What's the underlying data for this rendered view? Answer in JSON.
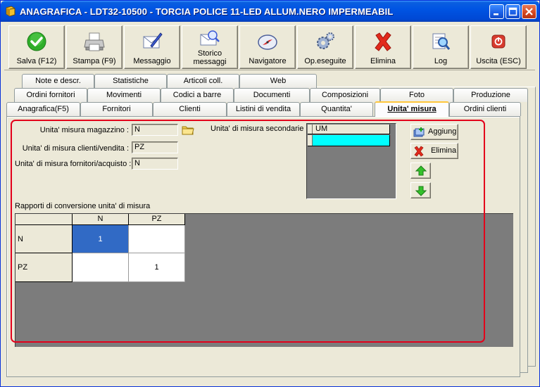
{
  "window": {
    "title": "ANAGRAFICA - LDT32-10500 - TORCIA POLICE 11-LED ALLUM.NERO IMPERMEABIL"
  },
  "toolbar": {
    "buttons": [
      {
        "label": "Salva (F12)",
        "icon": "check-icon"
      },
      {
        "label": "Stampa (F9)",
        "icon": "printer-icon"
      },
      {
        "label": "Messaggio",
        "icon": "message-icon"
      },
      {
        "label_line1": "Storico",
        "label_line2": "messaggi",
        "icon": "message-history-icon"
      },
      {
        "label": "Navigatore",
        "icon": "compass-icon"
      },
      {
        "label": "Op.eseguite",
        "icon": "gears-icon"
      },
      {
        "label": "Elimina",
        "icon": "delete-icon"
      },
      {
        "label": "Log",
        "icon": "log-icon"
      },
      {
        "label": "Uscita (ESC)",
        "icon": "exit-icon"
      }
    ]
  },
  "tabs": {
    "row1": [
      "Note e descr.",
      "Statistiche",
      "Articoli coll.",
      "Web"
    ],
    "row2": [
      "Ordini fornitori",
      "Movimenti",
      "Codici a barre",
      "Documenti",
      "Composizioni",
      "Foto",
      "Produzione"
    ],
    "row3": [
      "Anagrafica(F5)",
      "Fornitori",
      "Clienti",
      "Listini di vendita",
      "Quantita'",
      "Unita' misura",
      "Ordini clienti"
    ],
    "active": "Unita' misura"
  },
  "form": {
    "um_magazzino_label": "Unita' misura magazzino :",
    "um_magazzino_value": "N",
    "um_clienti_label": "Unita' di misura clienti/vendita :",
    "um_clienti_value": "PZ",
    "um_fornitori_label": "Unita' di misura fornitori/acquisto :",
    "um_fornitori_value": "N",
    "um_secondarie_label": "Unita' di misura secondarie :",
    "um_secondarie_header": "UM",
    "add_label": "Aggiung",
    "delete_label": "Elimina",
    "conversion_title": "Rapporti di conversione unita' di misura"
  },
  "conversion_grid": {
    "columns": [
      "N",
      "PZ"
    ],
    "rows": [
      {
        "label": "N",
        "values": [
          "1",
          ""
        ]
      },
      {
        "label": "PZ",
        "values": [
          "",
          "1"
        ]
      }
    ]
  },
  "colors": {
    "titlebar": "#0054e3",
    "highlight_outline": "#e3001b",
    "selected_row": "#00ffff",
    "selected_cell": "#316ac5"
  }
}
